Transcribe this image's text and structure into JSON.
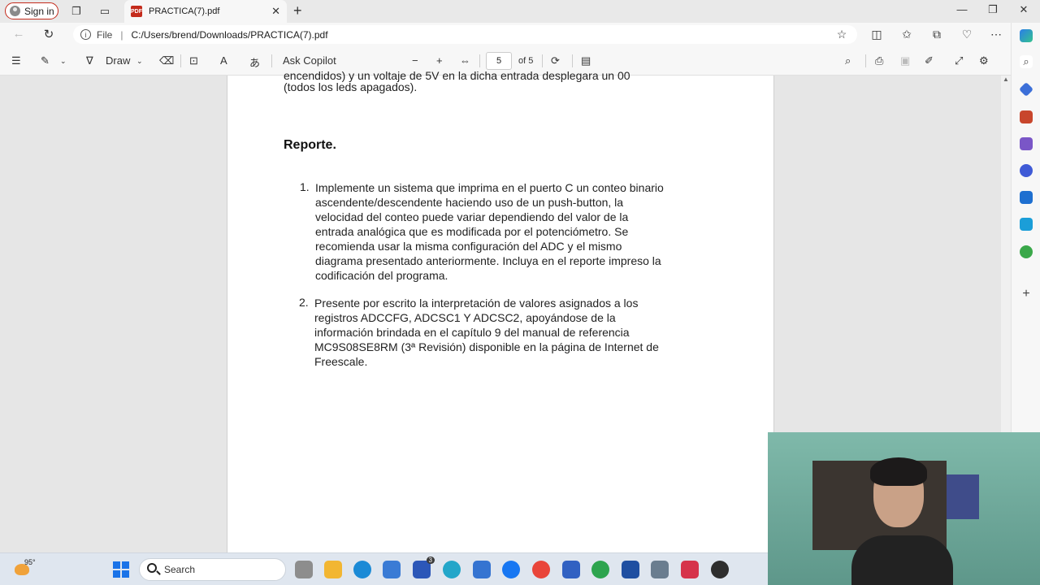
{
  "browser": {
    "signin_label": "Sign in",
    "tab_title": "PRACTICA(7).pdf",
    "tab_badge": "PDF",
    "address_scheme_label": "File",
    "address_url": "C:/Users/brend/Downloads/PRACTICA(7).pdf"
  },
  "pdf_toolbar": {
    "draw_label": "Draw",
    "ask_copilot_label": "Ask Copilot",
    "current_page": "5",
    "page_count_label": "of 5"
  },
  "document": {
    "cutoff_line": "encendidos) y un voltaje de 5V en la dicha entrada desplegara un 00",
    "continued_line": "(todos los leds apagados).",
    "heading": "Reporte.",
    "items": [
      {
        "number": "1.",
        "lines": [
          "Implemente un sistema que imprima en el puerto C un conteo binario",
          "ascendente/descendente haciendo uso de un push-button, la",
          "velocidad del conteo puede variar dependiendo del valor de la",
          "entrada analógica que es modificada por el potenciómetro. Se",
          "recomienda usar la misma configuración del ADC y el mismo",
          "diagrama presentado anteriormente. Incluya en el reporte impreso la",
          "codificación del programa."
        ]
      },
      {
        "number": "2.",
        "lines": [
          "Presente por escrito la interpretación de valores asignados a los",
          "registros ADCCFG, ADCSC1 Y ADCSC2, apoyándose de la",
          "información brindada en el capítulo 9  del manual de referencia",
          "MC9S08SE8RM (3ª Revisión) disponible en la página de Internet de",
          "Freescale."
        ]
      }
    ]
  },
  "taskbar": {
    "weather_temp": "95°",
    "search_label": "Search",
    "notification_count": "3"
  },
  "colors": {
    "accent": "#1a73e8",
    "pdf_red": "#c42b1c",
    "wall_green": "#6fa99a"
  }
}
